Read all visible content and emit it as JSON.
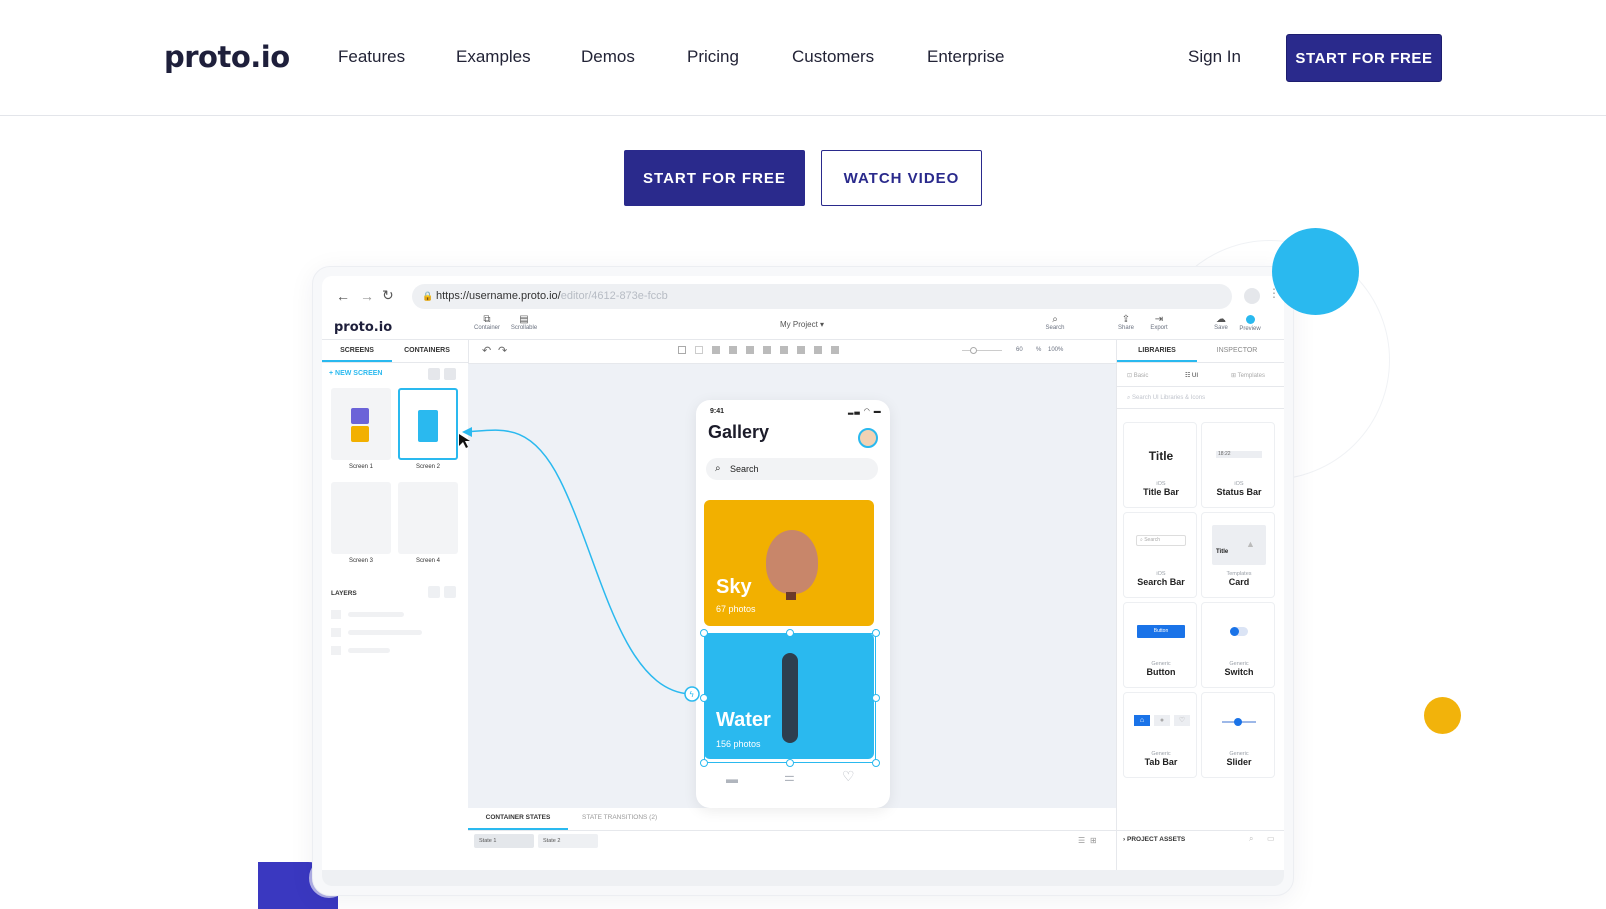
{
  "nav": {
    "logo": "proto.io",
    "links": [
      "Features",
      "Examples",
      "Demos",
      "Pricing",
      "Customers",
      "Enterprise"
    ],
    "sign_in": "Sign In",
    "cta": "START FOR FREE"
  },
  "hero": {
    "primary": "START FOR FREE",
    "secondary": "WATCH VIDEO"
  },
  "app": {
    "url_main": "https://username.proto.io/",
    "url_dim": "editor/4612-873e-fccb",
    "logo": "proto.io",
    "toolbar_left": [
      "Container",
      "Scrollable"
    ],
    "project": "My Project ▾",
    "toolbar_right": [
      "Search",
      "Share",
      "Export",
      "Save",
      "Preview"
    ],
    "left_tabs": [
      "SCREENS",
      "CONTAINERS"
    ],
    "new_screen": "+ NEW SCREEN",
    "screens": [
      "Screen 1",
      "Screen 2",
      "Screen 3",
      "Screen 4"
    ],
    "layers": "LAYERS",
    "zoom": [
      "60",
      "%",
      "100%"
    ],
    "right_tabs": [
      "LIBRARIES",
      "INSPECTOR"
    ],
    "lib_subtabs": [
      "Basic",
      "UI",
      "Templates"
    ],
    "lib_search": "Search UI Libraries & Icons",
    "library": [
      {
        "sub": "iOS",
        "title": "Title Bar",
        "preview": "Title"
      },
      {
        "sub": "iOS",
        "title": "Status Bar",
        "preview": "18:22"
      },
      {
        "sub": "iOS",
        "title": "Search Bar",
        "preview": "Search"
      },
      {
        "sub": "Templates",
        "title": "Card",
        "preview": "Title"
      },
      {
        "sub": "Generic",
        "title": "Button",
        "preview": "Button"
      },
      {
        "sub": "Generic",
        "title": "Switch",
        "preview": ""
      },
      {
        "sub": "Generic",
        "title": "Tab Bar",
        "preview": ""
      },
      {
        "sub": "Generic",
        "title": "Slider",
        "preview": ""
      }
    ],
    "bottom_tabs": [
      "CONTAINER STATES",
      "STATE TRANSITIONS (2)"
    ],
    "states": [
      "State 1",
      "State 2"
    ],
    "project_assets": "PROJECT ASSETS"
  },
  "phone": {
    "time": "9:41",
    "title": "Gallery",
    "search": "Search",
    "cards": [
      {
        "title": "Sky",
        "sub": "67 photos",
        "color": "#f2b000"
      },
      {
        "title": "Water",
        "sub": "156 photos",
        "color": "#2ab9ef"
      }
    ]
  },
  "colors": {
    "brand": "#2a2a8c",
    "accent_blue": "#2ab9ef",
    "accent_yellow": "#f2b30b"
  }
}
